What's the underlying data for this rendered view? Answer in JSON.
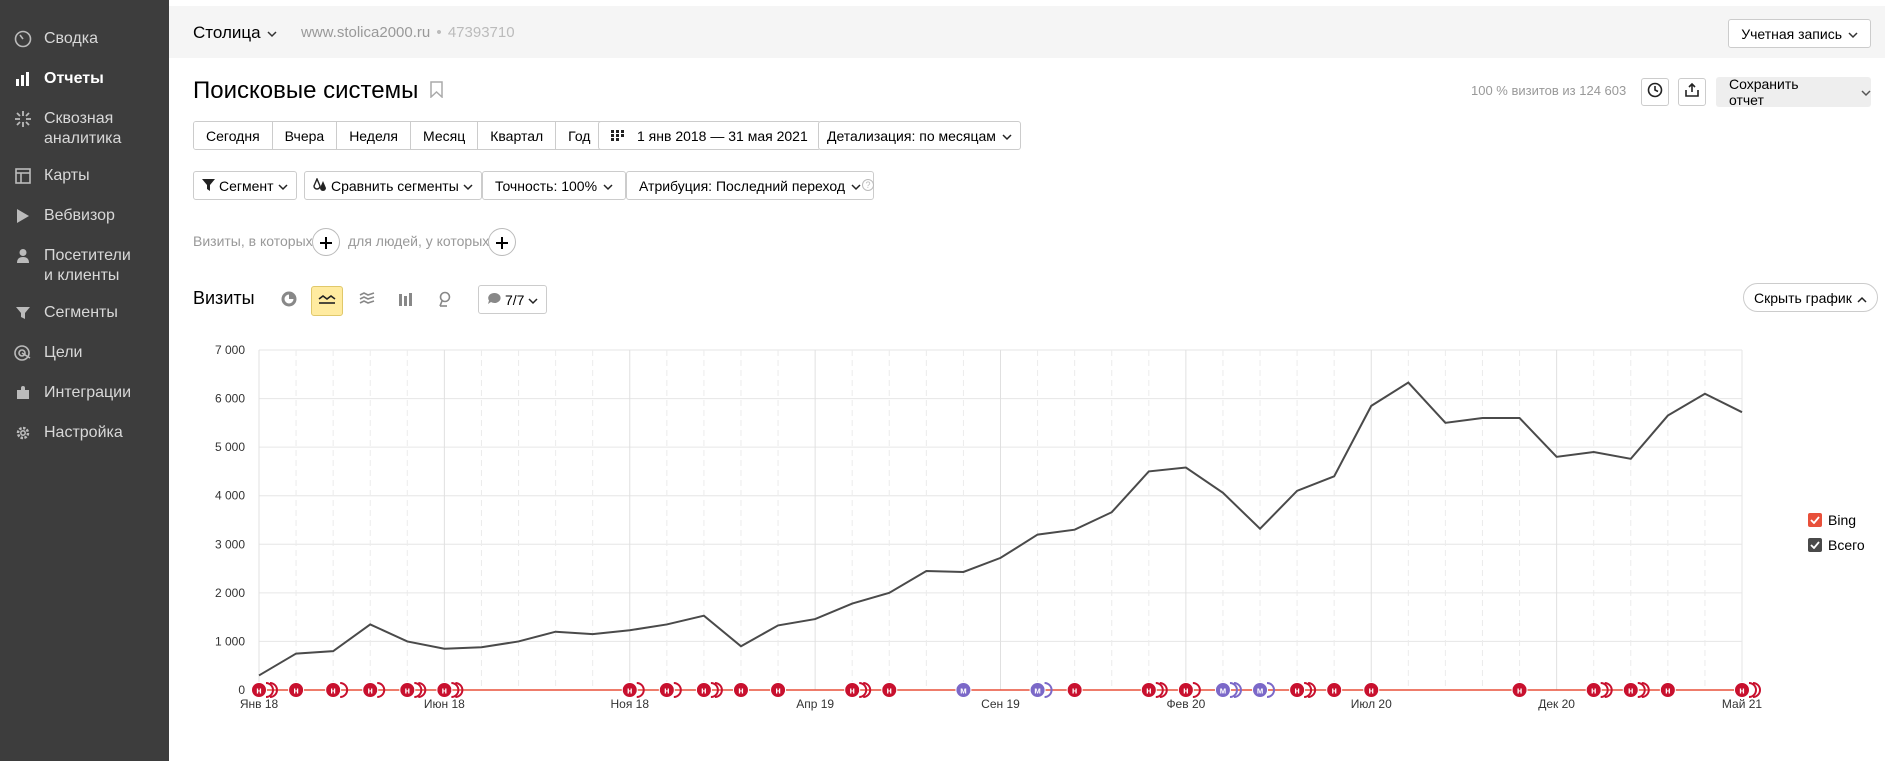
{
  "sidebar": {
    "items": [
      {
        "label": "Сводка",
        "icon": "gauge-icon"
      },
      {
        "label": "Отчеты",
        "icon": "bar-chart-icon",
        "active": true
      },
      {
        "label": "Сквозная аналитика",
        "icon": "spark-icon"
      },
      {
        "label": "Карты",
        "icon": "map-grid-icon"
      },
      {
        "label": "Вебвизор",
        "icon": "play-icon"
      },
      {
        "label": "Посетители и клиенты",
        "icon": "user-icon"
      },
      {
        "label": "Сегменты",
        "icon": "filter-icon"
      },
      {
        "label": "Цели",
        "icon": "target-icon"
      },
      {
        "label": "Интеграции",
        "icon": "puzzle-icon"
      },
      {
        "label": "Настройка",
        "icon": "gear-icon"
      }
    ]
  },
  "topbar": {
    "site_name": "Столица",
    "site_url": "www.stolica2000.ru",
    "counter_sep": "•",
    "counter_id": "47393710",
    "account_label": "Учетная запись"
  },
  "header": {
    "title": "Поисковые системы",
    "visits_share": "100 % визитов из 124 603",
    "save_label": "Сохранить отчет"
  },
  "periods": [
    "Сегодня",
    "Вчера",
    "Неделя",
    "Месяц",
    "Квартал",
    "Год"
  ],
  "date_range": "1 янв 2018 — 31 мая 2021",
  "detail": "Детализация: по месяцам",
  "filters": {
    "segment": "Сегмент",
    "compare": "Сравнить сегменты",
    "accuracy": "Точность: 100%",
    "attribution": "Атрибуция: Последний переход"
  },
  "conditions": {
    "visits_where": "Визиты, в которых",
    "people_where": "для людей, у которых"
  },
  "chart_controls": {
    "metric": "Визиты",
    "annotations": "7/7",
    "hide_chart": "Скрыть график"
  },
  "colors": {
    "accent": "#ffeba0",
    "bing": "#e8503a",
    "total": "#4a4a4a",
    "marker_red": "#c8102e",
    "marker_purple": "#7b68c8"
  },
  "chart_data": {
    "type": "line",
    "ylim": [
      0,
      7000
    ],
    "yticks": [
      "0",
      "1 000",
      "2 000",
      "3 000",
      "4 000",
      "5 000",
      "6 000",
      "7 000"
    ],
    "xtick_labels": [
      {
        "label": "Янв 18",
        "index": 0
      },
      {
        "label": "Июн 18",
        "index": 5
      },
      {
        "label": "Ноя 18",
        "index": 10
      },
      {
        "label": "Апр 19",
        "index": 15
      },
      {
        "label": "Сен 19",
        "index": 20
      },
      {
        "label": "Фев 20",
        "index": 25
      },
      {
        "label": "Июл 20",
        "index": 30
      },
      {
        "label": "Дек 20",
        "index": 35
      },
      {
        "label": "Май 21",
        "index": 40
      }
    ],
    "series": [
      {
        "name": "Всего",
        "color": "#4a4a4a",
        "values": [
          300,
          750,
          800,
          1350,
          1000,
          850,
          880,
          1000,
          1200,
          1150,
          1230,
          1350,
          1530,
          900,
          1330,
          1460,
          1780,
          2000,
          2450,
          2430,
          2720,
          3200,
          3300,
          3660,
          4500,
          4580,
          4060,
          3320,
          4100,
          4400,
          5850,
          6330,
          5500,
          5600,
          5600,
          4800,
          4900,
          4760,
          5650,
          6100,
          5720
        ]
      },
      {
        "name": "Bing",
        "color": "#e8503a",
        "values": [
          0,
          0,
          0,
          0,
          0,
          0,
          0,
          0,
          0,
          0,
          0,
          0,
          0,
          0,
          0,
          0,
          0,
          0,
          0,
          0,
          0,
          0,
          0,
          0,
          0,
          0,
          0,
          0,
          0,
          0,
          0,
          0,
          0,
          0,
          0,
          0,
          0,
          0,
          0,
          0,
          0
        ]
      }
    ],
    "legend": [
      "Bing",
      "Всего"
    ],
    "legend_position": "right",
    "grid": true,
    "annotation_markers": [
      {
        "index": 0,
        "kind": "red",
        "count": 3
      },
      {
        "index": 1,
        "kind": "red",
        "count": 1
      },
      {
        "index": 2,
        "kind": "red",
        "count": 2
      },
      {
        "index": 3,
        "kind": "red",
        "count": 2
      },
      {
        "index": 4,
        "kind": "red",
        "count": 3
      },
      {
        "index": 5,
        "kind": "red",
        "count": 3
      },
      {
        "index": 10,
        "kind": "red",
        "count": 2
      },
      {
        "index": 11,
        "kind": "red",
        "count": 2
      },
      {
        "index": 12,
        "kind": "red",
        "count": 3
      },
      {
        "index": 13,
        "kind": "red",
        "count": 1
      },
      {
        "index": 14,
        "kind": "red",
        "count": 1
      },
      {
        "index": 16,
        "kind": "red",
        "count": 3
      },
      {
        "index": 17,
        "kind": "red",
        "count": 1
      },
      {
        "index": 19,
        "kind": "purple",
        "count": 1
      },
      {
        "index": 21,
        "kind": "purple",
        "count": 2
      },
      {
        "index": 22,
        "kind": "red",
        "count": 1
      },
      {
        "index": 24,
        "kind": "red",
        "count": 3
      },
      {
        "index": 25,
        "kind": "red",
        "count": 2
      },
      {
        "index": 26,
        "kind": "purple",
        "count": 3
      },
      {
        "index": 27,
        "kind": "purple",
        "count": 2
      },
      {
        "index": 28,
        "kind": "red",
        "count": 3
      },
      {
        "index": 29,
        "kind": "red",
        "count": 1
      },
      {
        "index": 30,
        "kind": "red",
        "count": 1
      },
      {
        "index": 34,
        "kind": "red",
        "count": 1
      },
      {
        "index": 36,
        "kind": "red",
        "count": 3
      },
      {
        "index": 37,
        "kind": "red",
        "count": 3
      },
      {
        "index": 38,
        "kind": "red",
        "count": 1
      },
      {
        "index": 40,
        "kind": "red",
        "count": 3
      }
    ],
    "marker_glyph": "н",
    "marker_glyph_purple": "м"
  }
}
